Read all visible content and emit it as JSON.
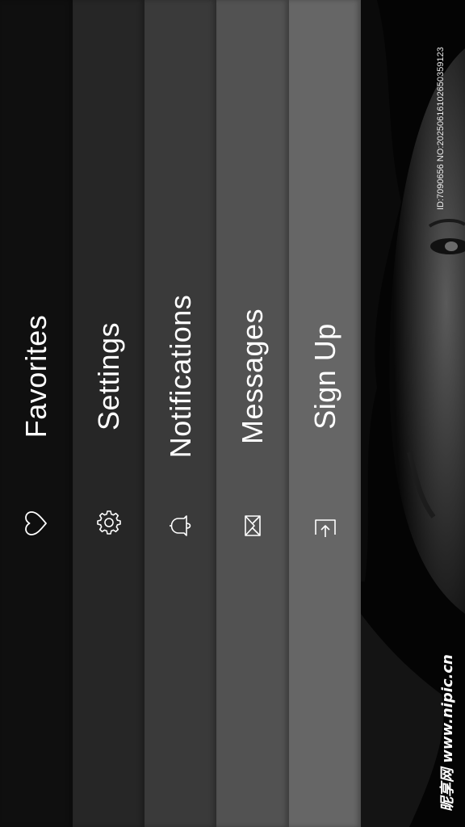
{
  "menu": {
    "items": [
      {
        "label": "Favorites",
        "icon": "heart-icon",
        "color": "#0f0f0f"
      },
      {
        "label": "Settings",
        "icon": "gear-icon",
        "color": "#262626"
      },
      {
        "label": "Notifications",
        "icon": "bell-icon",
        "color": "#3a3a3a"
      },
      {
        "label": "Messages",
        "icon": "envelope-icon",
        "color": "#525252"
      },
      {
        "label": "Sign Up",
        "icon": "sign-in-icon",
        "color": "#666666"
      }
    ]
  },
  "photo": {
    "image_id": "ID:7090656 NO:20250616102650359123",
    "watermark": "昵享网 www.nipic.cn"
  }
}
